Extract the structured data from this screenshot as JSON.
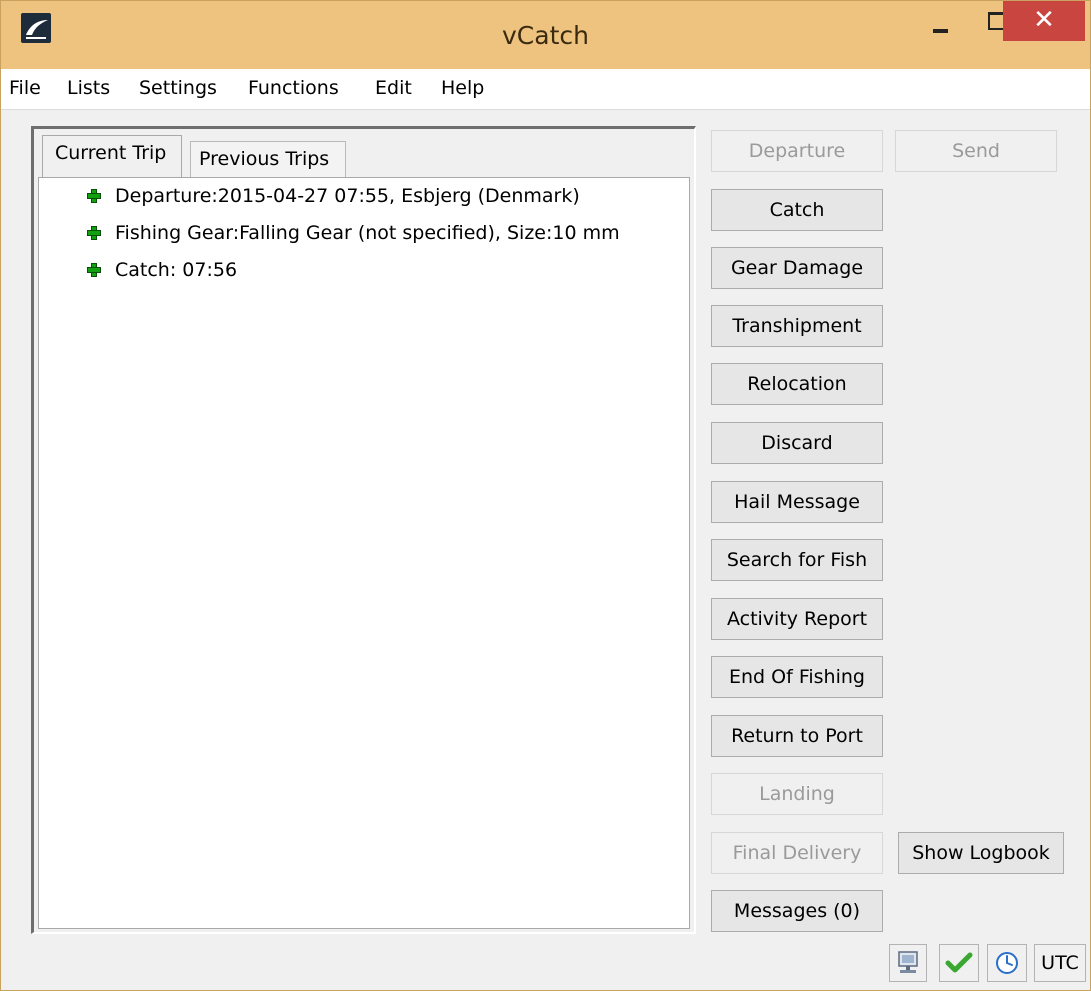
{
  "window": {
    "title": "vCatch",
    "close_glyph": "✕"
  },
  "menu": [
    "File",
    "Lists",
    "Settings",
    "Functions",
    "Edit",
    "Help"
  ],
  "tabs": {
    "current": "Current Trip",
    "previous": "Previous Trips"
  },
  "tree": [
    "Departure:2015-04-27 07:55,  Esbjerg (Denmark)",
    "Fishing Gear:Falling Gear (not specified), Size:10 mm",
    "Catch: 07:56"
  ],
  "buttons": {
    "departure": "Departure",
    "send": "Send",
    "catch": "Catch",
    "gear_damage": "Gear Damage",
    "transhipment": "Transhipment",
    "relocation": "Relocation",
    "discard": "Discard",
    "hail_message": "Hail Message",
    "search_for_fish": "Search for Fish",
    "activity_report": "Activity Report",
    "end_of_fishing": "End Of Fishing",
    "return_to_port": "Return to Port",
    "landing": "Landing",
    "final_delivery": "Final Delivery",
    "show_logbook": "Show Logbook",
    "messages": "Messages (0)"
  },
  "status": {
    "timezone": "UTC",
    "icons": [
      "computer-icon",
      "checkmark-icon",
      "clock-icon"
    ]
  },
  "colors": {
    "titlebar": "#eec380",
    "close": "#c8463f",
    "tree_plus": "#10a010",
    "check": "#3aa830",
    "clock": "#2a6fc9"
  }
}
